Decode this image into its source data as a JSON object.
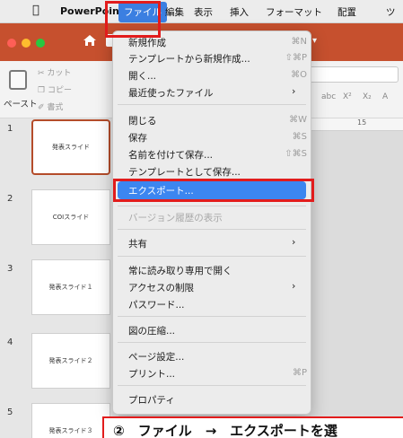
{
  "menubar": {
    "app_name": "PowerPoint",
    "items": [
      "ファイル",
      "編集",
      "表示",
      "挿入",
      "フォーマット",
      "配置",
      "ツ"
    ]
  },
  "ribbon": {
    "paste_label": "ペースト",
    "cut_label": "カット",
    "copy_label": "コピー",
    "format_label": "書式",
    "format_buttons": [
      "abc",
      "X²",
      "X₂",
      "A"
    ],
    "ruler_mark": "15"
  },
  "slides": [
    {
      "number": "1",
      "title": "発表スライド"
    },
    {
      "number": "2",
      "title": "COIスライド"
    },
    {
      "number": "3",
      "title": "発表スライド１"
    },
    {
      "number": "4",
      "title": "発表スライド２"
    },
    {
      "number": "5",
      "title": "発表スライド３"
    }
  ],
  "file_menu": {
    "new": {
      "label": "新規作成",
      "shortcut": "⌘N"
    },
    "new_from_template": {
      "label": "テンプレートから新規作成...",
      "shortcut": "⇧⌘P"
    },
    "open": {
      "label": "開く...",
      "shortcut": "⌘O"
    },
    "recent": {
      "label": "最近使ったファイル"
    },
    "close": {
      "label": "閉じる",
      "shortcut": "⌘W"
    },
    "save": {
      "label": "保存",
      "shortcut": "⌘S"
    },
    "save_as": {
      "label": "名前を付けて保存...",
      "shortcut": "⇧⌘S"
    },
    "save_as_template": {
      "label": "テンプレートとして保存..."
    },
    "export": {
      "label": "エクスポート..."
    },
    "version_history": {
      "label": "バージョン履歴の表示"
    },
    "share": {
      "label": "共有"
    },
    "always_readonly": {
      "label": "常に読み取り専用で開く"
    },
    "restrict_access": {
      "label": "アクセスの制限"
    },
    "password": {
      "label": "パスワード..."
    },
    "compress_pictures": {
      "label": "図の圧縮..."
    },
    "page_setup": {
      "label": "ページ設定..."
    },
    "print": {
      "label": "プリント...",
      "shortcut": "⌘P"
    },
    "properties": {
      "label": "プロパティ"
    }
  },
  "note": "②　ファイル　→　エクスポートを選"
}
